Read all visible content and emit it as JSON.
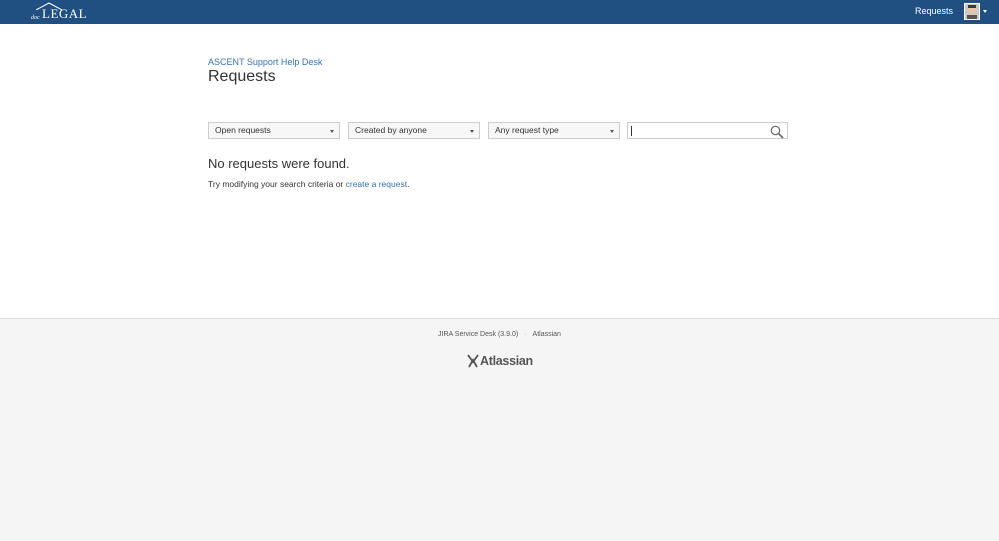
{
  "header": {
    "logo": {
      "small_text": "doc",
      "big_text": "LEGAL"
    },
    "nav_requests": "Requests",
    "colors": {
      "bar": "#205081"
    },
    "icons": {
      "avatar": "user-avatar",
      "avatar_menu": "chevron-down-icon"
    }
  },
  "breadcrumb": "ASCENT Support Help Desk",
  "page_title": "Requests",
  "filters": {
    "status": "Open requests",
    "creator": "Created by anyone",
    "request_type": "Any request type",
    "search_value": ""
  },
  "empty_state": {
    "title": "No requests were found.",
    "text_prefix": "Try modifying your search criteria or ",
    "link": "create a request",
    "text_suffix": "."
  },
  "footer": {
    "product": "JIRA Service Desk (3.9.0)",
    "separator": "·",
    "vendor": "Atlassian",
    "logo_text": "Atlassian"
  },
  "link_color": "#3572b0"
}
